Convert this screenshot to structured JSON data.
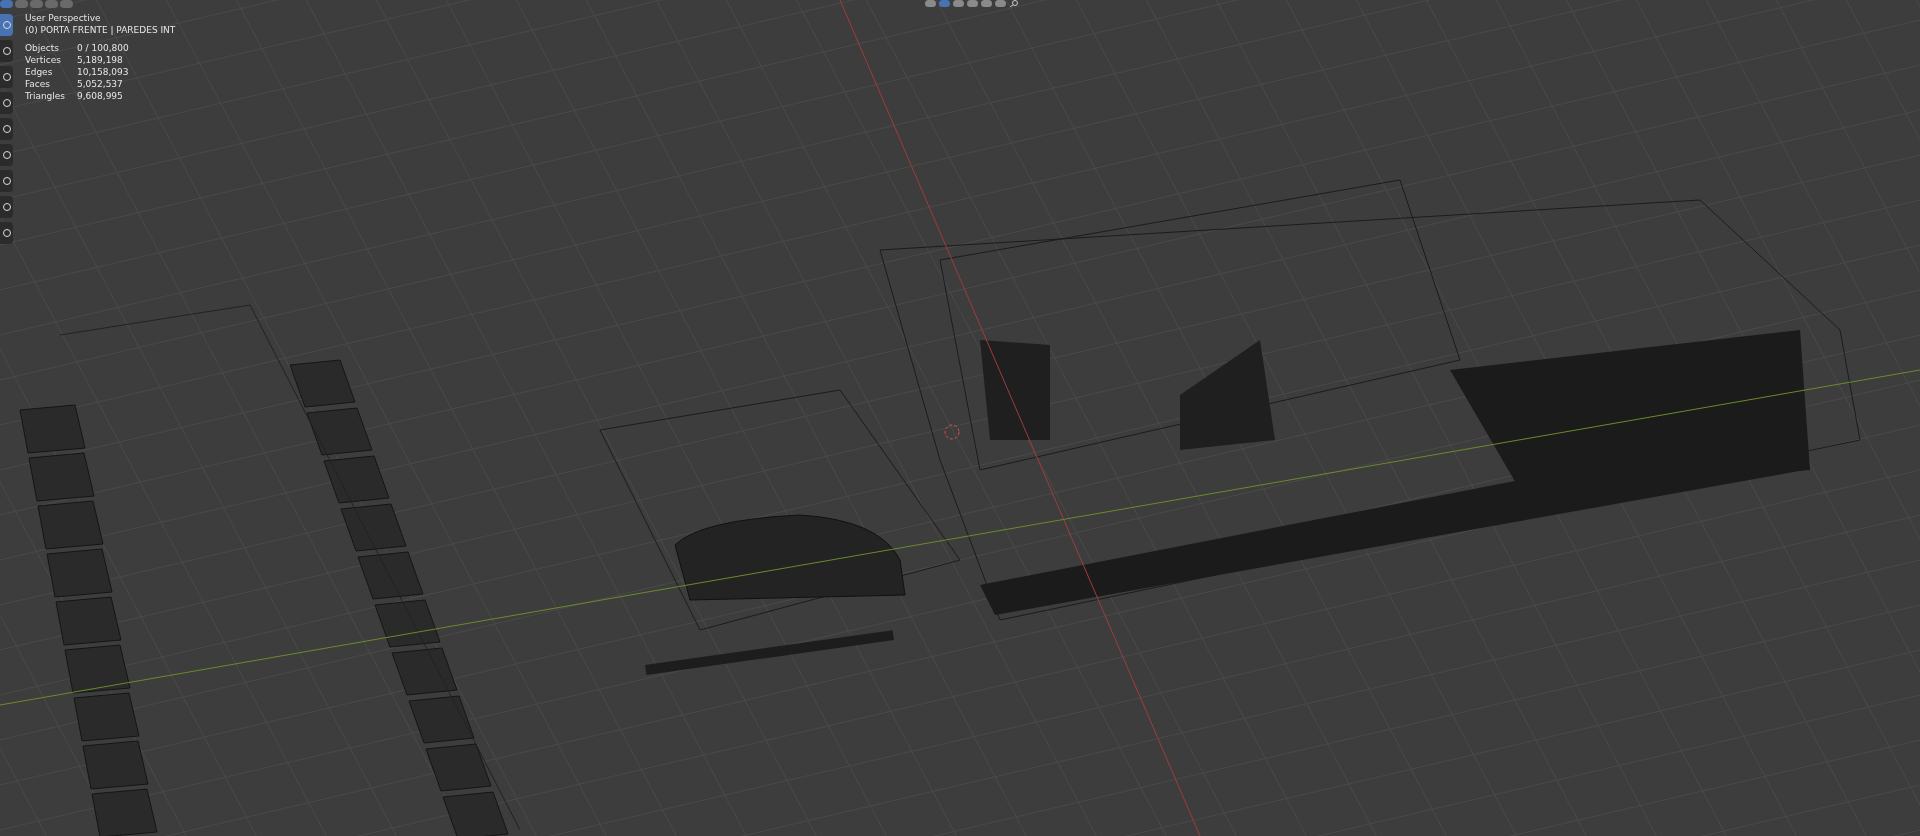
{
  "viewport": {
    "view_name": "User Perspective",
    "active_object": "(0) PORTA FRENTE | PAREDES INT",
    "stats": [
      {
        "label": "Objects",
        "value": "0 / 100,800"
      },
      {
        "label": "Vertices",
        "value": "5,189,198"
      },
      {
        "label": "Edges",
        "value": "10,158,093"
      },
      {
        "label": "Faces",
        "value": "5,052,537"
      },
      {
        "label": "Triangles",
        "value": "9,608,995"
      }
    ]
  },
  "toolbar": [
    {
      "selected": true
    },
    {
      "selected": false
    },
    {
      "selected": false
    },
    {
      "selected": false
    },
    {
      "selected": false
    },
    {
      "selected": false
    },
    {
      "selected": false
    },
    {
      "selected": false
    },
    {
      "selected": false
    }
  ],
  "header_modes": [
    {
      "selected": true
    },
    {
      "selected": false
    },
    {
      "selected": false
    },
    {
      "selected": false
    },
    {
      "selected": false
    }
  ],
  "shading_buttons": [
    {
      "selected": false
    },
    {
      "selected": true
    },
    {
      "selected": false
    },
    {
      "selected": false
    },
    {
      "selected": false
    },
    {
      "selected": false
    }
  ]
}
